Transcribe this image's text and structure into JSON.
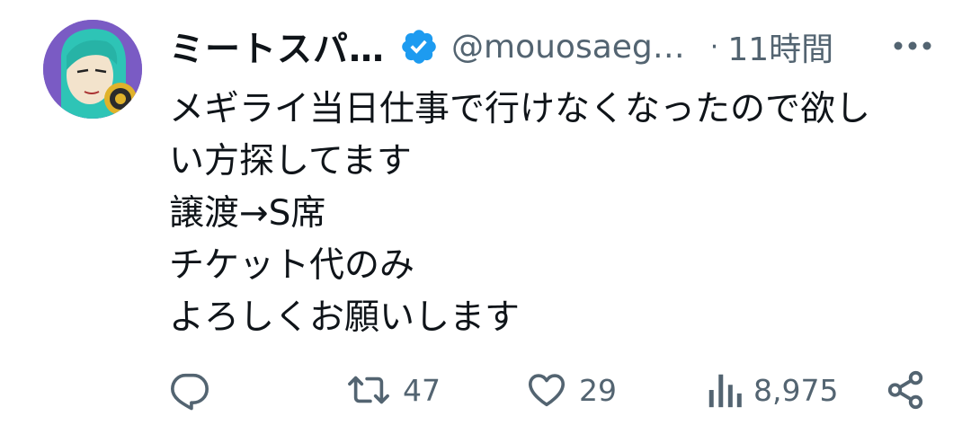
{
  "tweet": {
    "author": {
      "display_name": "ミートスパ…",
      "handle": "@mouosaeg…",
      "verified": true,
      "avatar": "anime-character-avatar"
    },
    "separator": "·",
    "time": "11時間",
    "more_icon": "more-horizontal-icon",
    "text_lines": [
      "メギライ当日仕事で行けなくなったので欲し",
      "い方探してます",
      "譲渡→S席",
      "チケット代のみ",
      "よろしくお願いします"
    ]
  },
  "actions": {
    "reply": {
      "icon": "reply-icon",
      "count": ""
    },
    "retweet": {
      "icon": "retweet-icon",
      "count": "47"
    },
    "like": {
      "icon": "heart-icon",
      "count": "29"
    },
    "views": {
      "icon": "views-chart-icon",
      "count": "8,975"
    },
    "share": {
      "icon": "share-icon"
    }
  },
  "colors": {
    "text_primary": "#0f1419",
    "text_secondary": "#536471",
    "verified_blue": "#1d9bf0",
    "avatar_bg": "#7a5bc4"
  }
}
